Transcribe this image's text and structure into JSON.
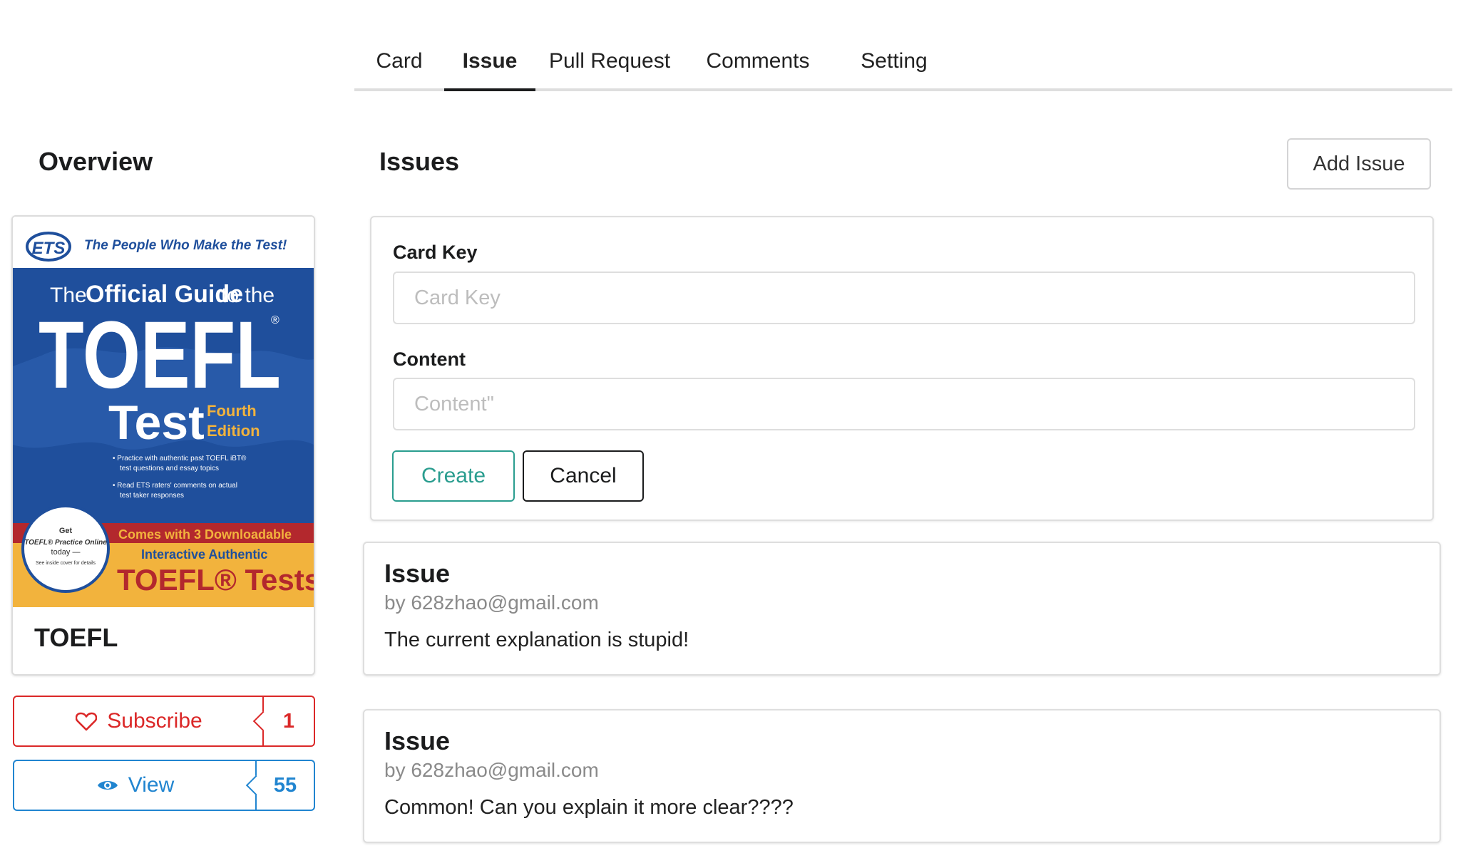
{
  "tabs": [
    {
      "label": "Card",
      "active": false
    },
    {
      "label": "Issue",
      "active": true
    },
    {
      "label": "Pull Request",
      "active": false
    },
    {
      "label": "Comments",
      "active": false
    },
    {
      "label": "Setting",
      "active": false
    }
  ],
  "overview": {
    "title": "Overview",
    "card": {
      "name": "TOEFL",
      "cover": {
        "publisher": "ETS",
        "tagline": "The People Who Make the Test!",
        "line1_a": "The",
        "line1_b": "Official Guide",
        "line1_c": "to the",
        "big_title": "TOEFL",
        "registered": "®",
        "test_word": "Test",
        "edition_1": "Fourth",
        "edition_2": "Edition",
        "bullet_1a": "• Practice with authentic past TOEFL iBT®",
        "bullet_1b": "test questions and essay topics",
        "bullet_2a": "• Read ETS raters' comments on actual",
        "bullet_2b": "test taker responses",
        "badge_1": "Get",
        "badge_2": "TOEFL® Practice Online",
        "badge_3": "today —",
        "badge_4": "See inside cover for details",
        "strip_text": "Comes with 3 Downloadable",
        "bottom_1": "Interactive Authentic",
        "bottom_2": "TOEFL® Tests",
        "colors": {
          "blue": "#1f4f9c",
          "red": "#b3282d",
          "yellow": "#f2b33d"
        }
      }
    },
    "subscribe": {
      "label": "Subscribe",
      "count": "1",
      "icon": "heart-icon",
      "color": "#db2828"
    },
    "view": {
      "label": "View",
      "count": "55",
      "icon": "eye-icon",
      "color": "#2185d0"
    }
  },
  "issues": {
    "title": "Issues",
    "add_label": "Add Issue",
    "form": {
      "card_key_label": "Card Key",
      "card_key_placeholder": "Card Key",
      "card_key_value": "",
      "content_label": "Content",
      "content_placeholder": "Content\"",
      "content_value": "",
      "create_label": "Create",
      "cancel_label": "Cancel",
      "create_color": "#2a9d8f"
    },
    "list": [
      {
        "title": "Issue",
        "author": "by 628zhao@gmail.com",
        "body": "The current explanation is stupid!"
      },
      {
        "title": "Issue",
        "author": "by 628zhao@gmail.com",
        "body": "Common! Can you explain it more clear????"
      }
    ]
  }
}
